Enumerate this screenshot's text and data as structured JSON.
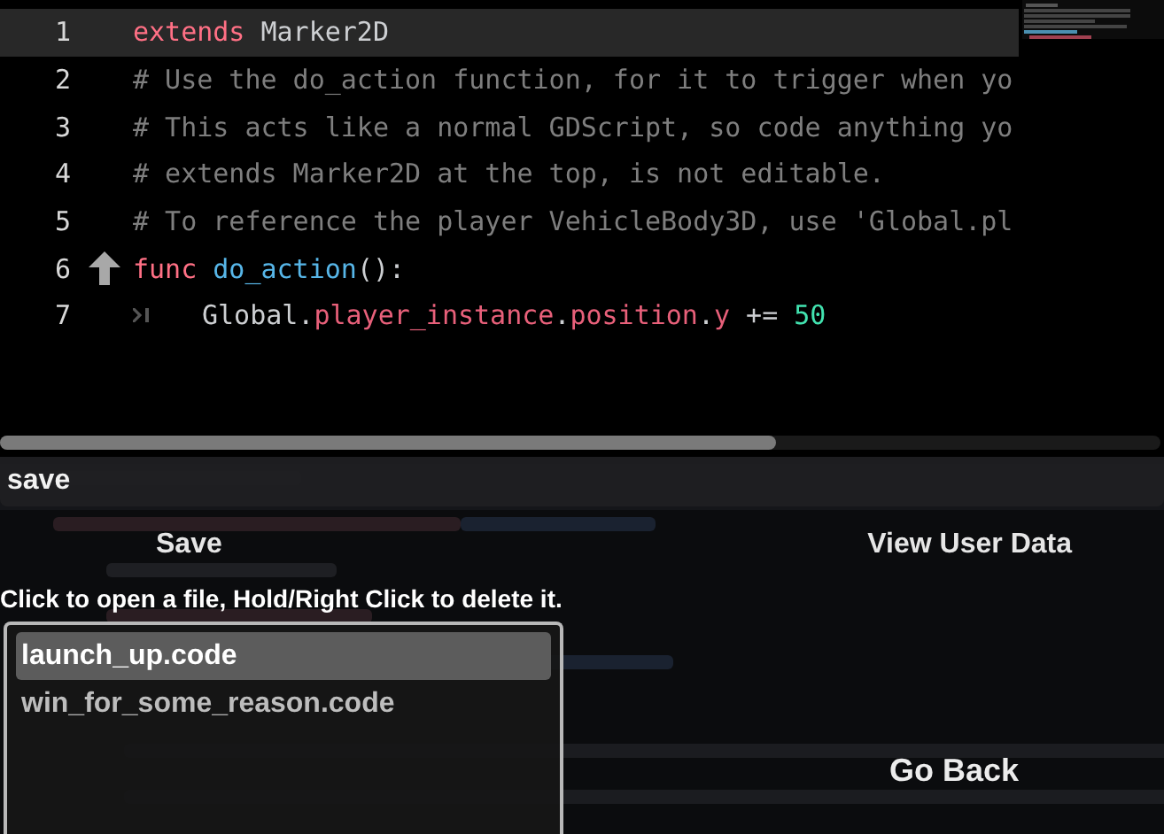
{
  "editor": {
    "lines": [
      {
        "number": "1",
        "current": true,
        "fold_arrow": false,
        "tab_marker": false,
        "tokens": [
          {
            "text": "extends",
            "kind": "keyword"
          },
          {
            "text": " Marker2D",
            "kind": "plain"
          }
        ]
      },
      {
        "number": "2",
        "current": false,
        "fold_arrow": false,
        "tab_marker": false,
        "tokens": [
          {
            "text": "# Use the do_action function, for it to trigger when yo",
            "kind": "comment"
          }
        ]
      },
      {
        "number": "3",
        "current": false,
        "fold_arrow": false,
        "tab_marker": false,
        "tokens": [
          {
            "text": "# This acts like a normal GDScript, so code anything yo",
            "kind": "comment"
          }
        ]
      },
      {
        "number": "4",
        "current": false,
        "fold_arrow": false,
        "tab_marker": false,
        "tokens": [
          {
            "text": "# extends Marker2D at the top, is not editable.",
            "kind": "comment"
          }
        ]
      },
      {
        "number": "5",
        "current": false,
        "fold_arrow": false,
        "tab_marker": false,
        "tokens": [
          {
            "text": "# To reference the player VehicleBody3D, use 'Global.pl",
            "kind": "comment"
          }
        ]
      },
      {
        "number": "6",
        "current": false,
        "fold_arrow": true,
        "tab_marker": false,
        "tokens": [
          {
            "text": "func ",
            "kind": "keyword"
          },
          {
            "text": "do_action",
            "kind": "function"
          },
          {
            "text": "():",
            "kind": "plain"
          }
        ]
      },
      {
        "number": "7",
        "current": false,
        "fold_arrow": false,
        "tab_marker": true,
        "tokens": [
          {
            "text": "Global.",
            "kind": "plain"
          },
          {
            "text": "player_instance",
            "kind": "member"
          },
          {
            "text": ".",
            "kind": "plain"
          },
          {
            "text": "position",
            "kind": "member"
          },
          {
            "text": ".",
            "kind": "plain"
          },
          {
            "text": "y",
            "kind": "member"
          },
          {
            "text": " += ",
            "kind": "plain"
          },
          {
            "text": "50",
            "kind": "number"
          }
        ]
      }
    ]
  },
  "save_field": {
    "value": "save"
  },
  "buttons": [
    {
      "label": "Save"
    },
    {
      "label": "View User Data"
    }
  ],
  "hint": "Click to open a file, Hold/Right Click to delete it.",
  "files": [
    {
      "name": "launch_up.code",
      "selected": true
    },
    {
      "name": "win_for_some_reason.code",
      "selected": false
    }
  ],
  "back_button": {
    "label": "Go Back"
  }
}
